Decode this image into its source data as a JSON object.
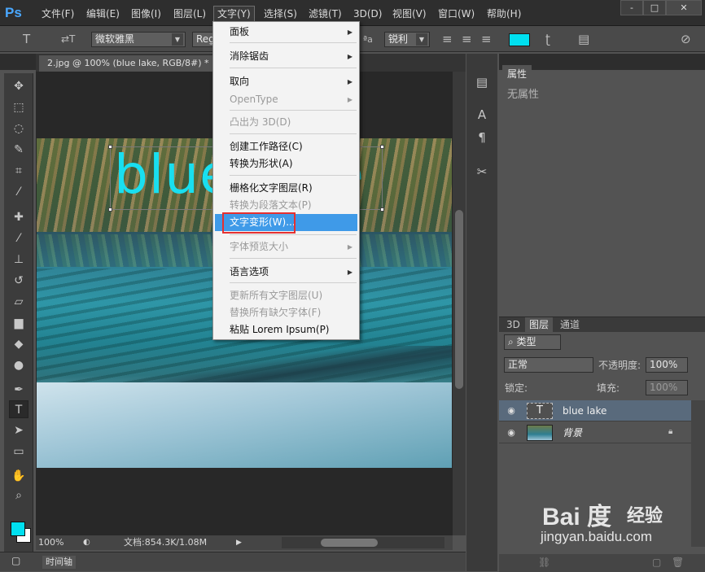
{
  "app": {
    "logo": "Ps",
    "menu": [
      "文件(F)",
      "编辑(E)",
      "图像(I)",
      "图层(L)",
      "文字(Y)",
      "选择(S)",
      "滤镜(T)",
      "3D(D)",
      "视图(V)",
      "窗口(W)",
      "帮助(H)"
    ],
    "active_menu": "文字(Y)",
    "window_controls": [
      "-",
      "□",
      "✕"
    ]
  },
  "options_bar": {
    "tool_glyph": "T",
    "orient_glyph": "⇄T",
    "font_family": "微软雅黑",
    "font_style": "Reg",
    "aa_glyph": "ªa",
    "antialias": "锐利",
    "text_color": "#00e0f0"
  },
  "document": {
    "tab_title": "2.jpg @ 100% (blue lake, RGB/8#) *",
    "tab_close": "×",
    "text_layer_content": "blue lake",
    "text_color": "#19dff0"
  },
  "status": {
    "zoom": "100%",
    "doc_info": "文档:854.3K/1.08M"
  },
  "timeline": {
    "label": "时间轴"
  },
  "properties_panel": {
    "tab": "属性",
    "empty_text": "无属性"
  },
  "layers_panel": {
    "tabs": [
      "3D",
      "图层",
      "通道"
    ],
    "filter_kind": "类型",
    "blend_mode": "正常",
    "opacity_label": "不透明度:",
    "opacity_value": "100%",
    "lock_label": "锁定:",
    "fill_label": "填充:",
    "fill_value": "100%",
    "layers": [
      {
        "name": "blue lake",
        "type": "text",
        "thumb_glyph": "T",
        "selected": true
      },
      {
        "name": "背景",
        "type": "image",
        "selected": false,
        "locked": true
      }
    ]
  },
  "text_menu": {
    "items": [
      {
        "label": "面板",
        "submenu": true,
        "disabled": false
      },
      {
        "label": "消除锯齿",
        "submenu": true,
        "disabled": false
      },
      {
        "label": "取向",
        "submenu": true,
        "disabled": false
      },
      {
        "label": "OpenType",
        "submenu": true,
        "disabled": true
      },
      {
        "label": "凸出为 3D(D)",
        "submenu": false,
        "disabled": true
      },
      {
        "label": "创建工作路径(C)",
        "submenu": false,
        "disabled": false
      },
      {
        "label": "转换为形状(A)",
        "submenu": false,
        "disabled": false
      },
      {
        "label": "栅格化文字图层(R)",
        "submenu": false,
        "disabled": false
      },
      {
        "label": "转换为段落文本(P)",
        "submenu": false,
        "disabled": true
      },
      {
        "label": "文字变形(W)...",
        "submenu": false,
        "disabled": false,
        "highlighted": true
      },
      {
        "label": "字体预览大小",
        "submenu": true,
        "disabled": true
      },
      {
        "label": "语言选项",
        "submenu": true,
        "disabled": false
      },
      {
        "label": "更新所有文字图层(U)",
        "submenu": false,
        "disabled": true
      },
      {
        "label": "替换所有缺欠字体(F)",
        "submenu": false,
        "disabled": true
      },
      {
        "label": "粘贴 Lorem Ipsum(P)",
        "submenu": false,
        "disabled": false
      }
    ]
  },
  "watermark": {
    "logo": "Bai 度",
    "text": "经验",
    "url": "jingyan.baidu.com"
  }
}
